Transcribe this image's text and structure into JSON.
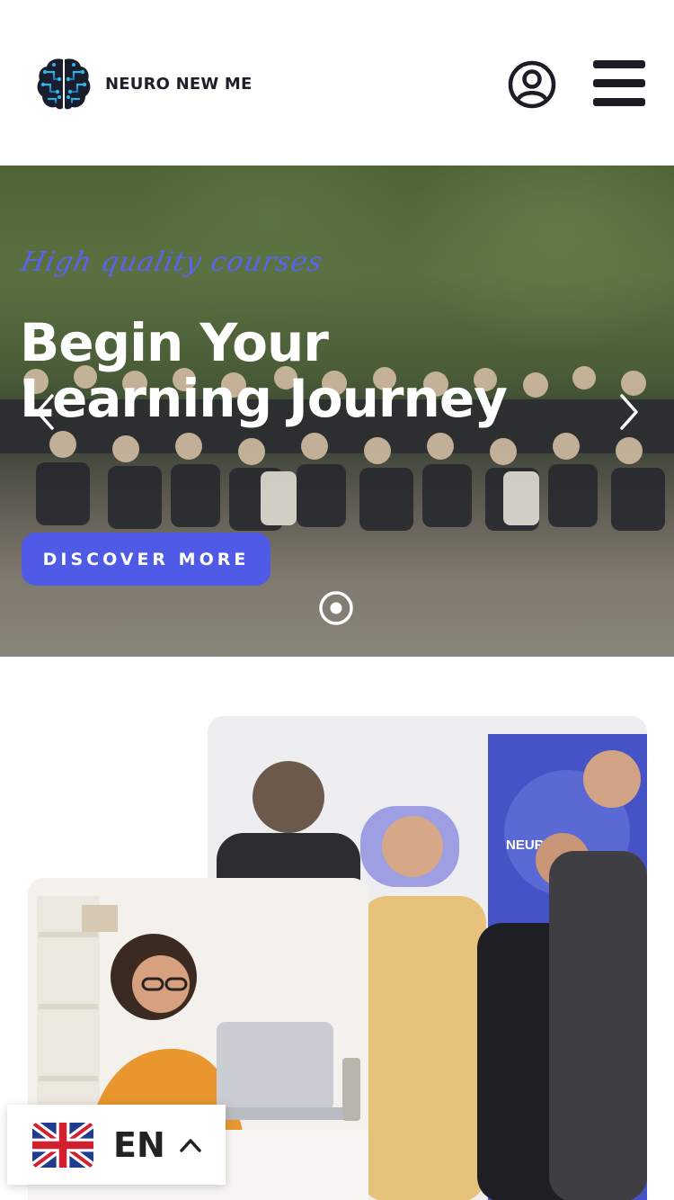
{
  "header": {
    "brand_name": "NEURO NEW ME",
    "logo_icon": "brain-circuit-logo",
    "account_icon": "user-circle-icon",
    "menu_icon": "hamburger-menu-icon"
  },
  "hero": {
    "script_tagline": "High quality courses",
    "title": "Begin Your Learning Journey",
    "cta_label": "DISCOVER MORE",
    "prev_icon": "chevron-left-icon",
    "next_icon": "chevron-right-icon",
    "slide_indicator_icon": "radio-dot-icon"
  },
  "gallery": {
    "photo_group_icon": "group-seminar-photo",
    "photo_laptop_icon": "woman-laptop-photo",
    "banner_text": "NEURO"
  },
  "language_switcher": {
    "code": "EN",
    "flag_icon": "uk-flag-icon",
    "toggle_icon": "chevron-up-icon"
  },
  "colors": {
    "accent": "#4f5ae6",
    "script": "#5a63f0",
    "text_dark": "#1d1f2a",
    "logo_blue": "#2a9bd8"
  }
}
